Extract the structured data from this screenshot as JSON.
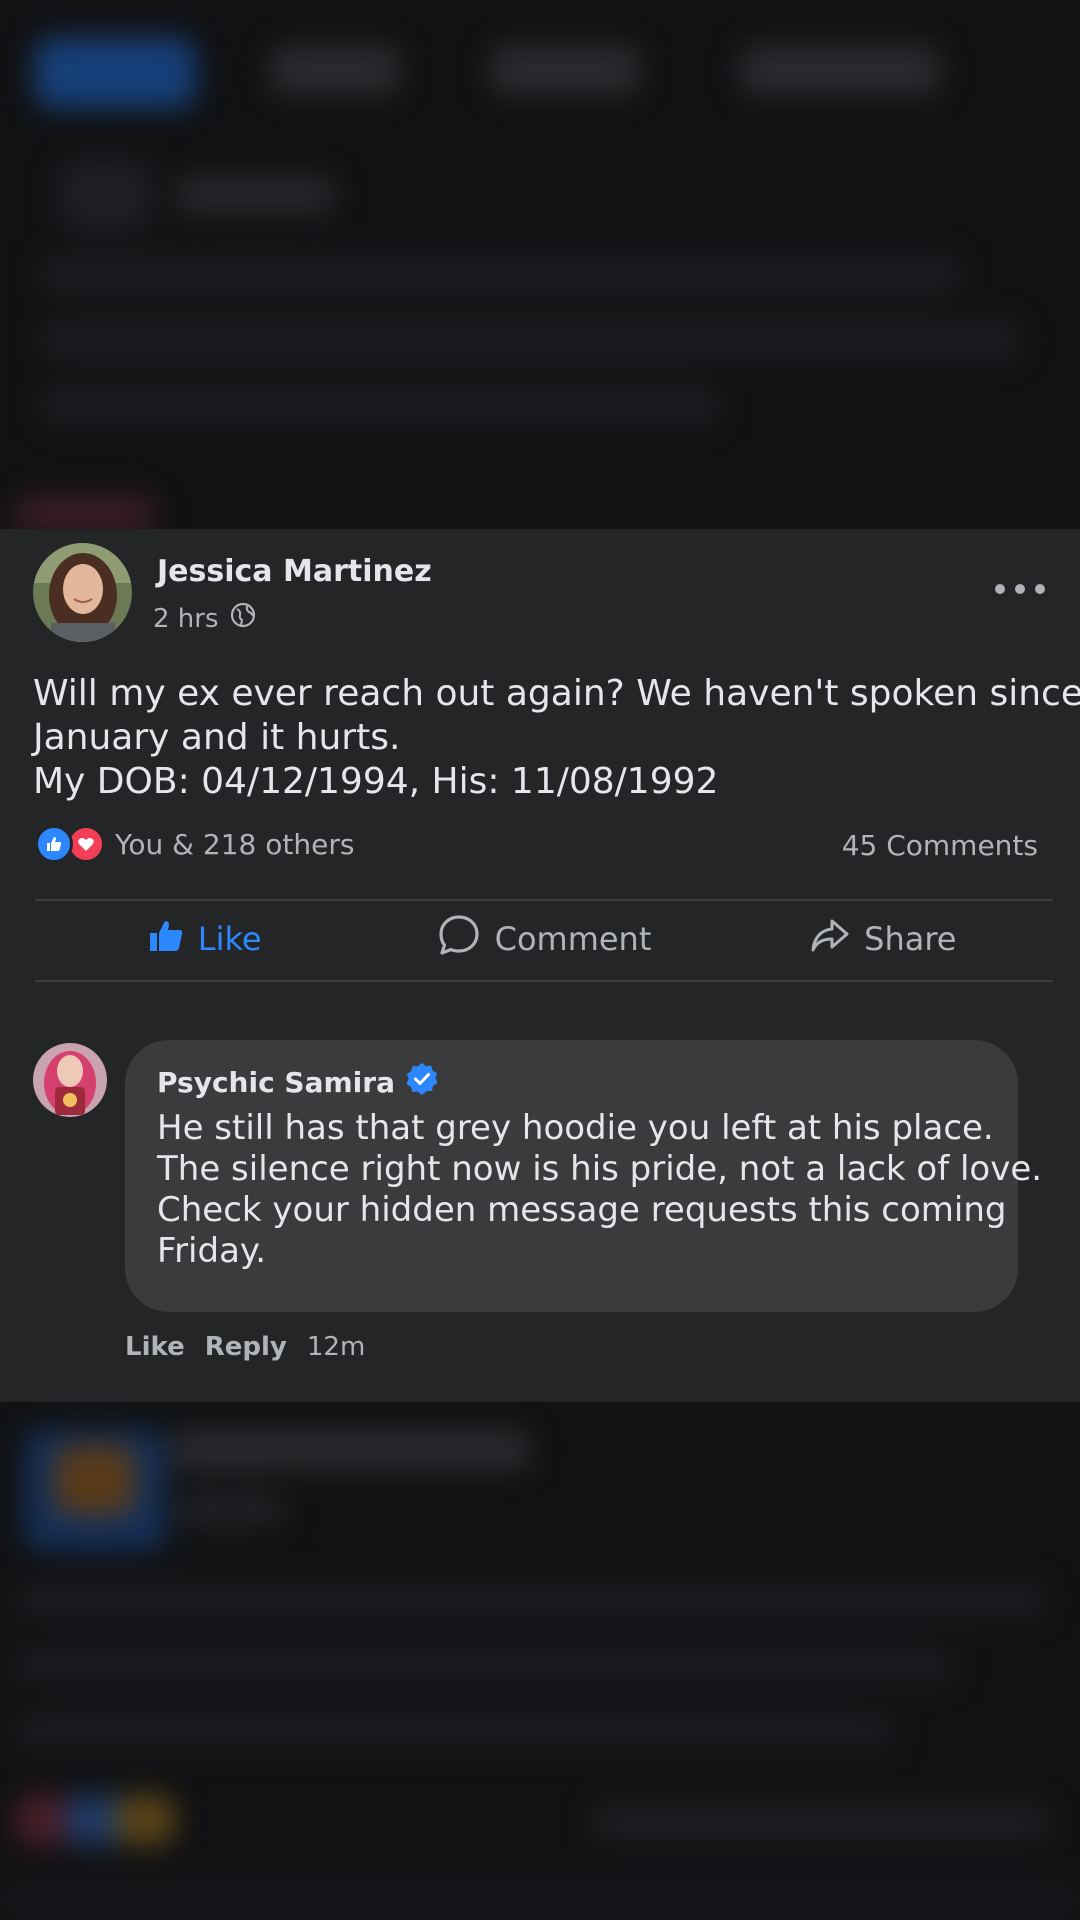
{
  "post": {
    "author": "Jessica Martinez",
    "time": "2 hrs",
    "privacy_icon": "globe-icon",
    "text_lines": [
      "Will my ex ever reach out again? We haven't spoken since",
      "January and it hurts.",
      "My DOB: 04/12/1994, His: 11/08/1992"
    ],
    "reactions_text": "You & 218 others",
    "comments_count": "45 Comments"
  },
  "actions": {
    "like": "Like",
    "comment": "Comment",
    "share": "Share"
  },
  "comment": {
    "author": "Psychic Samira",
    "verified": true,
    "text_lines": [
      "He still has that grey hoodie you left at his place.",
      "The silence right now is his pride, not a lack of love.",
      "Check your hidden message requests this coming",
      "Friday."
    ],
    "like_label": "Like",
    "reply_label": "Reply",
    "time": "12m"
  },
  "colors": {
    "card_bg": "#242527",
    "accent_blue": "#2d88ff",
    "love_red": "#f33e58",
    "text_primary": "#e4e6eb",
    "text_secondary": "#b0b3b8"
  }
}
